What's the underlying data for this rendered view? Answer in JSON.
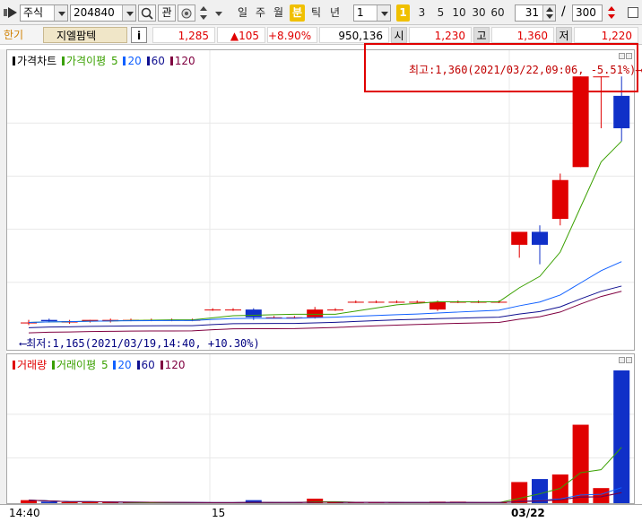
{
  "toolbar": {
    "market_select": "주식",
    "code": "204840",
    "watch_label": "관",
    "period_tabs": [
      "일",
      "주",
      "월",
      "분",
      "틱",
      "년"
    ],
    "active_period": "분",
    "interval_value": "1",
    "minute_options": [
      "1",
      "3",
      "5",
      "10",
      "30",
      "60"
    ],
    "active_minute": "1",
    "count_value": "31",
    "divider": "/",
    "total_value": "300"
  },
  "quote": {
    "toggle": "한기",
    "name": "지엘팜텍",
    "info_label": "i",
    "price": "1,285",
    "change": "▲105",
    "change_pct": "+8.90%",
    "volume": "950,136",
    "open_label": "시",
    "open": "1,230",
    "high_label": "고",
    "high": "1,360",
    "low_label": "저",
    "low": "1,220"
  },
  "price_pane": {
    "legend_title": "가격차트",
    "ma_legend": "가격이평",
    "ma_periods": [
      "5",
      "20",
      "60",
      "120"
    ],
    "high_annotation": "최고:1,360(2021/03/22,09:06, -5.51%)⟶",
    "low_annotation": "⟵최저:1,165(2021/03/19,14:40, +10.30%)"
  },
  "volume_pane": {
    "legend_title": "거래량",
    "ma_legend": "거래이평",
    "ma_periods": [
      "5",
      "20",
      "60",
      "120"
    ]
  },
  "xaxis": {
    "labels": [
      "14:40",
      "15",
      "03/22"
    ]
  },
  "colors": {
    "up": "#e00000",
    "down": "#1030c8",
    "ma5": "#3aa000",
    "ma20": "#1060ff",
    "ma60": "#101090",
    "ma120": "#800040",
    "highlight_box": "#e00000",
    "active_tab": "#f0c000"
  },
  "chart_data": {
    "type": "candlestick",
    "title": "가격차트",
    "candles": [
      {
        "i": 0,
        "o": 1170,
        "h": 1172,
        "l": 1168,
        "c": 1170
      },
      {
        "i": 1,
        "o": 1172,
        "h": 1173,
        "l": 1170,
        "c": 1171
      },
      {
        "i": 2,
        "o": 1170,
        "h": 1172,
        "l": 1169,
        "c": 1171
      },
      {
        "i": 3,
        "o": 1171,
        "h": 1172,
        "l": 1170,
        "c": 1172
      },
      {
        "i": 4,
        "o": 1171,
        "h": 1173,
        "l": 1170,
        "c": 1172
      },
      {
        "i": 5,
        "o": 1172,
        "h": 1173,
        "l": 1171,
        "c": 1172
      },
      {
        "i": 6,
        "o": 1172,
        "h": 1173,
        "l": 1171,
        "c": 1172
      },
      {
        "i": 7,
        "o": 1172,
        "h": 1173,
        "l": 1171,
        "c": 1172
      },
      {
        "i": 8,
        "o": 1172,
        "h": 1173,
        "l": 1171,
        "c": 1172
      },
      {
        "i": 9,
        "o": 1180,
        "h": 1181,
        "l": 1179,
        "c": 1180
      },
      {
        "i": 10,
        "o": 1180,
        "h": 1181,
        "l": 1179,
        "c": 1180
      },
      {
        "i": 11,
        "o": 1180,
        "h": 1181,
        "l": 1172,
        "c": 1174
      },
      {
        "i": 12,
        "o": 1174,
        "h": 1175,
        "l": 1173,
        "c": 1174
      },
      {
        "i": 13,
        "o": 1174,
        "h": 1175,
        "l": 1173,
        "c": 1174
      },
      {
        "i": 14,
        "o": 1174,
        "h": 1182,
        "l": 1173,
        "c": 1180
      },
      {
        "i": 15,
        "o": 1180,
        "h": 1181,
        "l": 1179,
        "c": 1180
      },
      {
        "i": 16,
        "o": 1186,
        "h": 1187,
        "l": 1185,
        "c": 1186
      },
      {
        "i": 17,
        "o": 1186,
        "h": 1187,
        "l": 1185,
        "c": 1186
      },
      {
        "i": 18,
        "o": 1186,
        "h": 1187,
        "l": 1185,
        "c": 1186
      },
      {
        "i": 19,
        "o": 1186,
        "h": 1187,
        "l": 1185,
        "c": 1186
      },
      {
        "i": 20,
        "o": 1180,
        "h": 1187,
        "l": 1179,
        "c": 1186
      },
      {
        "i": 21,
        "o": 1186,
        "h": 1187,
        "l": 1185,
        "c": 1186
      },
      {
        "i": 22,
        "o": 1186,
        "h": 1187,
        "l": 1185,
        "c": 1186
      },
      {
        "i": 23,
        "o": 1186,
        "h": 1187,
        "l": 1185,
        "c": 1186
      },
      {
        "i": 24,
        "o": 1230,
        "h": 1240,
        "l": 1220,
        "c": 1240
      },
      {
        "i": 25,
        "o": 1240,
        "h": 1245,
        "l": 1215,
        "c": 1230
      },
      {
        "i": 26,
        "o": 1250,
        "h": 1285,
        "l": 1245,
        "c": 1280
      },
      {
        "i": 27,
        "o": 1290,
        "h": 1360,
        "l": 1290,
        "c": 1360
      },
      {
        "i": 28,
        "o": 1360,
        "h": 1360,
        "l": 1320,
        "c": 1360
      },
      {
        "i": 29,
        "o": 1345,
        "h": 1360,
        "l": 1310,
        "c": 1320
      }
    ],
    "volume": [
      2,
      1,
      0,
      1,
      0,
      0,
      0,
      0,
      0,
      0,
      0,
      2,
      0,
      0,
      3,
      0,
      0,
      0,
      0,
      0,
      1,
      1,
      0,
      0,
      14,
      16,
      19,
      52,
      10,
      88
    ],
    "ylim": [
      1160,
      1365
    ],
    "xlabels": [
      "14:40",
      "15",
      "03/22"
    ]
  }
}
